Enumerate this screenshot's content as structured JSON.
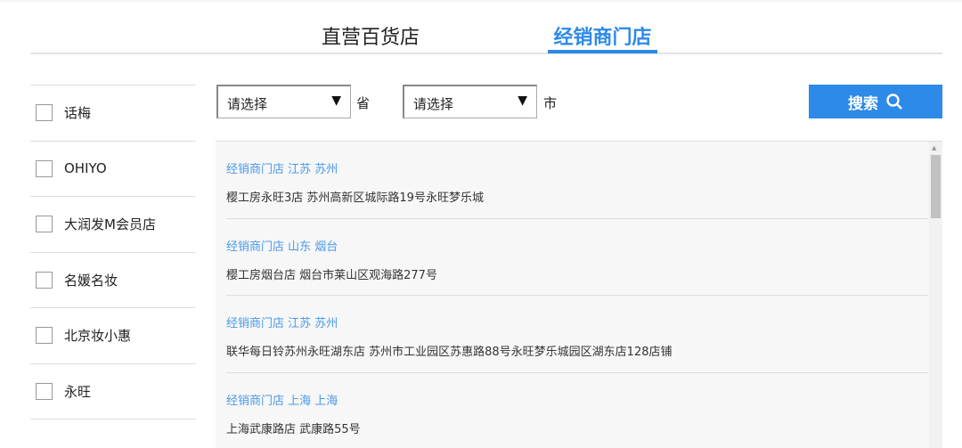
{
  "tabs": [
    {
      "label": "直营百货店"
    },
    {
      "label": "经销商门店"
    }
  ],
  "brands": [
    {
      "label": "话梅"
    },
    {
      "label": "OHIYO"
    },
    {
      "label": "大润发M会员店"
    },
    {
      "label": "名媛名妆"
    },
    {
      "label": "北京妆小惠"
    },
    {
      "label": "永旺"
    }
  ],
  "filters": {
    "province": {
      "value": "请选择",
      "unit": "省"
    },
    "city": {
      "value": "请选择",
      "unit": "市"
    },
    "search_label": "搜索"
  },
  "stores": [
    {
      "title": "经销商门店 江苏 苏州",
      "address": "樱工房永旺3店 苏州高新区城际路19号永旺梦乐城"
    },
    {
      "title": "经销商门店 山东 烟台",
      "address": "樱工房烟台店 烟台市莱山区观海路277号"
    },
    {
      "title": "经销商门店 江苏 苏州",
      "address": "联华每日铃苏州永旺湖东店 苏州市工业园区苏惠路88号永旺梦乐城园区湖东店128店铺"
    },
    {
      "title": "经销商门店 上海 上海",
      "address": "上海武康路店 武康路55号"
    }
  ],
  "colors": {
    "accent": "#2d8ae8",
    "link": "#4b9ae8"
  }
}
